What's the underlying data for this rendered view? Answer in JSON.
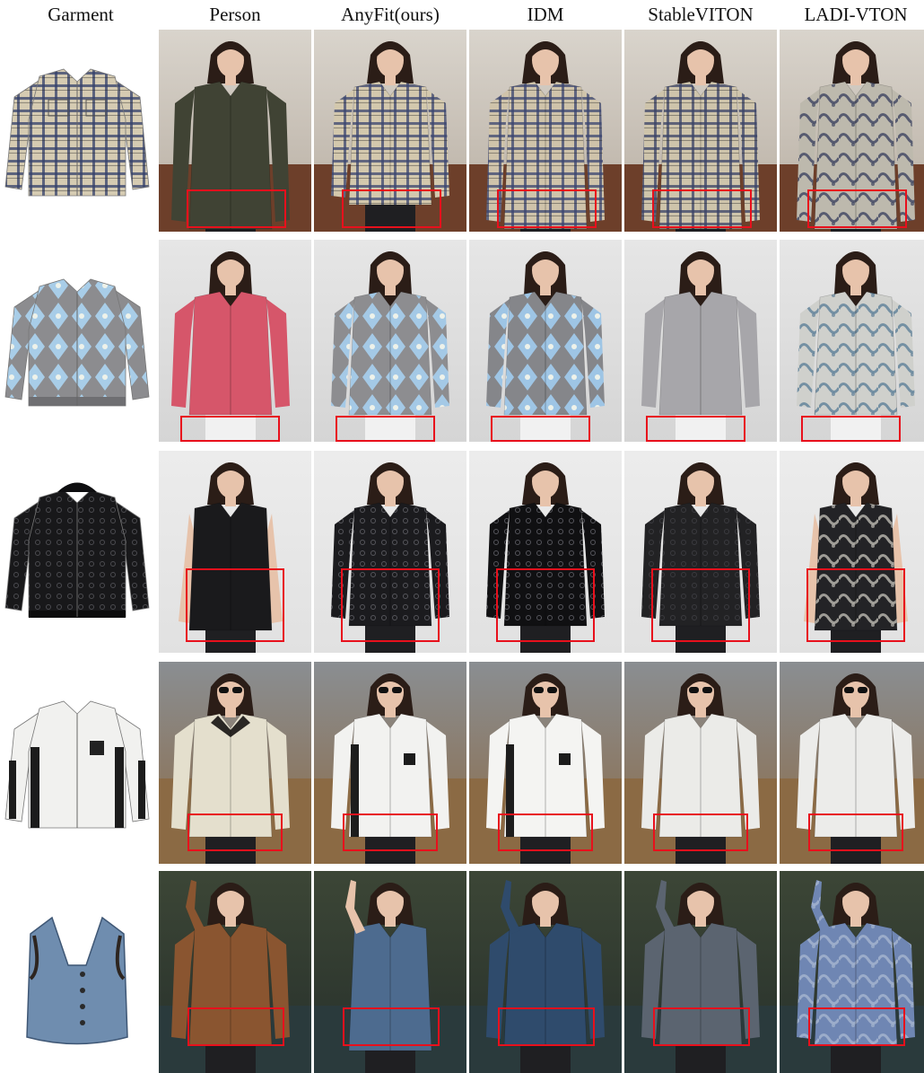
{
  "columns": [
    "Garment",
    "Person",
    "AnyFit(ours)",
    "IDM",
    "StableVITON",
    "LADI-VTON"
  ],
  "rows": [
    {
      "id": "plaid",
      "garment": "plaid-shirt",
      "bg": "#d9d4cc",
      "bg2": "#b7ada1",
      "colors": {
        "garment": "#d5cbb2",
        "accent": "#34406a",
        "dark": "#1b1b1e"
      },
      "outfits": [
        {
          "method": "Person",
          "type": "dress",
          "main": "#404334",
          "accent": "#b9a265",
          "pattern": "none"
        },
        {
          "method": "AnyFit(ours)",
          "type": "shirt",
          "main": "#d3c8ad",
          "accent": "#3a4570",
          "pattern": "plaid"
        },
        {
          "method": "IDM",
          "type": "dress",
          "main": "#cfc3aa",
          "accent": "#3a4570",
          "pattern": "plaid"
        },
        {
          "method": "StableVITON",
          "type": "dress",
          "main": "#cec4ab",
          "accent": "#394266",
          "pattern": "plaid"
        },
        {
          "method": "LADI-VTON",
          "type": "dress",
          "main": "#bdb9ad",
          "accent": "#3d4460",
          "pattern": "swirl"
        }
      ]
    },
    {
      "id": "cardigan",
      "garment": "argyle-cardigan",
      "bg": "#e6e6e6",
      "bg2": "#d5d5d5",
      "colors": {
        "garment": "#8c8c8f",
        "accent": "#a8cde8",
        "dark": "#3a2a22"
      },
      "outfits": [
        {
          "method": "Person",
          "type": "sweater",
          "main": "#d6566a",
          "accent": "#e27b8a",
          "pattern": "none"
        },
        {
          "method": "AnyFit(ours)",
          "type": "sweater",
          "main": "#8d8d90",
          "accent": "#a4c9e6",
          "pattern": "argyle"
        },
        {
          "method": "IDM",
          "type": "sweater",
          "main": "#85868a",
          "accent": "#9ec5e5",
          "pattern": "argyle"
        },
        {
          "method": "StableVITON",
          "type": "sweater",
          "main": "#a7a6aa",
          "accent": "#b9b8bd",
          "pattern": "none"
        },
        {
          "method": "LADI-VTON",
          "type": "sweater",
          "main": "#cfd0cc",
          "accent": "#5e7f98",
          "pattern": "swirl"
        }
      ]
    },
    {
      "id": "leather",
      "garment": "hooded-jacket",
      "bg": "#ececec",
      "bg2": "#e1e1e1",
      "colors": {
        "garment": "#18181a",
        "accent": "#4b4b50",
        "dark": "#0e0e10"
      },
      "outfits": [
        {
          "method": "Person",
          "type": "vest",
          "main": "#1a1a1c",
          "accent": "#c8a75a",
          "pattern": "none"
        },
        {
          "method": "AnyFit(ours)",
          "type": "jacket",
          "main": "#1b1b1e",
          "accent": "#55555b",
          "pattern": "dots"
        },
        {
          "method": "IDM",
          "type": "jacket",
          "main": "#101012",
          "accent": "#55555b",
          "pattern": "dots"
        },
        {
          "method": "StableVITON",
          "type": "jacket",
          "main": "#222224",
          "accent": "#3a3a3e",
          "pattern": "dots"
        },
        {
          "method": "LADI-VTON",
          "type": "vest",
          "main": "#232326",
          "accent": "#bdbab2",
          "pattern": "swirl"
        }
      ]
    },
    {
      "id": "white-jacket",
      "garment": "zip-jacket",
      "bg": "#8a8e92",
      "bg2": "#8c6a45",
      "colors": {
        "garment": "#f1f1ef",
        "accent": "#1c1c1c",
        "dark": "#2a2523"
      },
      "outfits": [
        {
          "method": "Person",
          "type": "jacket",
          "main": "#e4dfcd",
          "accent": "#262422",
          "pattern": "none"
        },
        {
          "method": "AnyFit(ours)",
          "type": "jacket",
          "main": "#f2f2f0",
          "accent": "#1d1d1d",
          "pattern": "stripe"
        },
        {
          "method": "IDM",
          "type": "jacket",
          "main": "#f4f4f2",
          "accent": "#1d1d1d",
          "pattern": "stripe"
        },
        {
          "method": "StableVITON",
          "type": "shirt",
          "main": "#ebebe8",
          "accent": "#2a2a2a",
          "pattern": "none"
        },
        {
          "method": "LADI-VTON",
          "type": "shirt",
          "main": "#ececea",
          "accent": "#222",
          "pattern": "none"
        }
      ]
    },
    {
      "id": "denim-vest",
      "garment": "denim-vest",
      "bg": "#3c4636",
      "bg2": "#27302b",
      "colors": {
        "garment": "#6f8daf",
        "accent": "#8ea8c5",
        "dark": "#1d1a18"
      },
      "outfits": [
        {
          "method": "Person",
          "type": "jacket",
          "main": "#8a5530",
          "accent": "#3d8e85",
          "pattern": "none"
        },
        {
          "method": "AnyFit(ours)",
          "type": "vest",
          "main": "#4d6b8f",
          "accent": "#7f9bbb",
          "pattern": "none"
        },
        {
          "method": "IDM",
          "type": "jacket",
          "main": "#2f4b6c",
          "accent": "#4b6a8f",
          "pattern": "none"
        },
        {
          "method": "StableVITON",
          "type": "jacket",
          "main": "#5b6470",
          "accent": "#7a838e",
          "pattern": "none"
        },
        {
          "method": "LADI-VTON",
          "type": "jacket",
          "main": "#6f86b3",
          "accent": "#a6b5cf",
          "pattern": "swirl"
        }
      ]
    }
  ]
}
